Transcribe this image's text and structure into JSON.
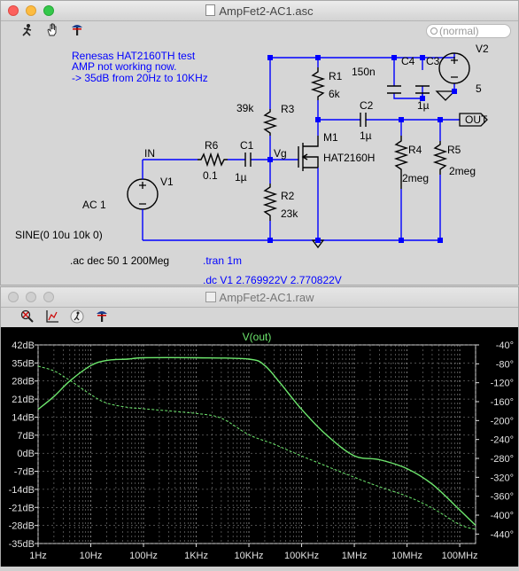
{
  "schematic_window": {
    "title": "AmpFet2-AC1.asc",
    "search_placeholder": "(normal)",
    "notes": {
      "line1": "Renesas HAT2160TH test",
      "line2": "AMP not working now.",
      "line3": "-> 35dB from 20Hz to 10KHz"
    },
    "labels": {
      "in_net": "IN",
      "vg_net": "Vg",
      "out_net": "OUT",
      "r6_name": "R6",
      "r6_value": "0.1",
      "c1_name": "C1",
      "c1_value": "1µ",
      "v1_name": "V1",
      "v1_value": "AC 1",
      "v1_sine": "SINE(0 10u 10k 0)",
      "r3_name": "R3",
      "r3_value": "39k",
      "r2_name": "R2",
      "r2_value": "23k",
      "r1_name": "R1",
      "r1_value": "6k",
      "m1_name": "M1",
      "m1_model": "HAT2160H",
      "c2_name": "C2",
      "c2_value": "1µ",
      "r4_name": "R4",
      "r4_value": "2meg",
      "r5_name": "R5",
      "r5_value": "2meg",
      "c4_name": "C4",
      "c4_value": "150n",
      "c3_name": "C3",
      "c3_value": "1µ",
      "v2_name": "V2",
      "v2_value": "5"
    },
    "directives": {
      "ac": ".ac dec 50 1 200Meg",
      "tran": ".tran 1m",
      "dc": ".dc V1 2.769922V 2.770822V"
    },
    "colors": {
      "wire": "#0000ff",
      "text": "#000000",
      "directive": "#0000ff",
      "background": "#d6d6d6"
    }
  },
  "plot_window": {
    "title": "AmpFet2-AC1.raw",
    "trace_name": "V(out)",
    "colors": {
      "trace": "#6ee86e",
      "background": "#000000",
      "axis_text": "#e0e0e0",
      "grid": "#9a9a9a"
    }
  },
  "chart_data": {
    "type": "line",
    "title": "V(out)",
    "x_scale": "log",
    "x_ticks": [
      "1Hz",
      "10Hz",
      "100Hz",
      "1KHz",
      "10KHz",
      "100KHz",
      "1MHz",
      "10MHz",
      "100MHz"
    ],
    "xlim": [
      1,
      200000000
    ],
    "y_ticks_left": [
      "42dB",
      "35dB",
      "28dB",
      "21dB",
      "14dB",
      "7dB",
      "0dB",
      "-7dB",
      "-14dB",
      "-21dB",
      "-28dB",
      "-35dB"
    ],
    "y_ticks_right": [
      "-40°",
      "-80°",
      "-120°",
      "-160°",
      "-200°",
      "-240°",
      "-280°",
      "-320°",
      "-360°",
      "-400°",
      "-440°"
    ],
    "ylim_left": [
      -35,
      42
    ],
    "ylim_right": [
      -460,
      -40
    ],
    "series": [
      {
        "name": "V(out)",
        "axis": "magnitude",
        "style": "solid",
        "x": [
          1,
          2,
          4,
          10,
          20,
          50,
          100,
          1000,
          10000,
          20000,
          40000,
          100000,
          300000,
          1000000,
          3000000,
          10000000,
          30000000,
          100000000,
          200000000
        ],
        "y": [
          17,
          22,
          28,
          34,
          36,
          36.5,
          37,
          37,
          36.5,
          34,
          27,
          17,
          7,
          -1,
          -2.5,
          -6,
          -12,
          -22,
          -28
        ]
      },
      {
        "name": "V(out) phase",
        "axis": "phase",
        "style": "dashed",
        "x": [
          1,
          2,
          4,
          10,
          20,
          50,
          100,
          1000,
          3000,
          10000,
          30000,
          100000,
          1000000,
          3000000,
          10000000,
          30000000,
          100000000,
          200000000
        ],
        "y": [
          -85,
          -95,
          -115,
          -145,
          -163,
          -172,
          -175,
          -185,
          -195,
          -230,
          -250,
          -275,
          -320,
          -340,
          -360,
          -385,
          -420,
          -430
        ]
      }
    ]
  }
}
